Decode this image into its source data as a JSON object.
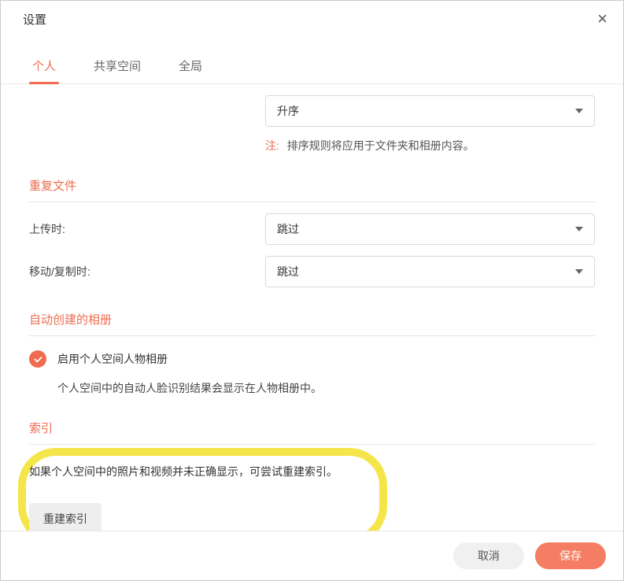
{
  "title": "设置",
  "tabs": {
    "personal": "个人",
    "shared": "共享空间",
    "global": "全局"
  },
  "sort": {
    "value": "升序",
    "note_label": "注:",
    "note_text": "排序规则将应用于文件夹和相册内容。"
  },
  "duplicate": {
    "title": "重复文件",
    "upload_label": "上传时:",
    "upload_value": "跳过",
    "move_label": "移动/复制时:",
    "move_value": "跳过"
  },
  "auto_album": {
    "title": "自动创建的相册",
    "checkbox_label": "启用个人空间人物相册",
    "desc": "个人空间中的自动人脸识别结果会显示在人物相册中。"
  },
  "index": {
    "title": "索引",
    "text": "如果个人空间中的照片和视频并未正确显示，可尝试重建索引。",
    "button": "重建索引"
  },
  "footer": {
    "cancel": "取消",
    "save": "保存"
  }
}
